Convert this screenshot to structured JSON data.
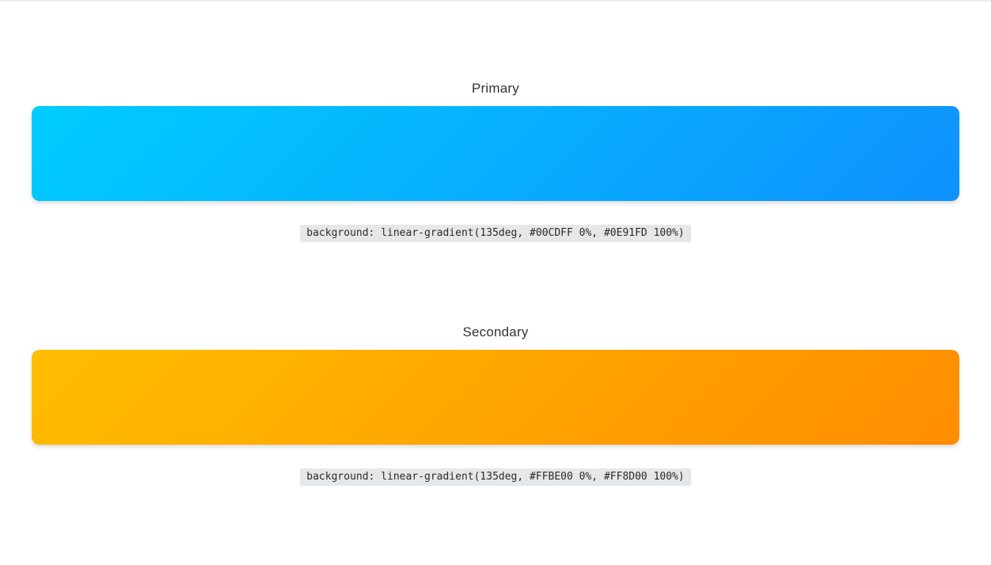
{
  "gradients": [
    {
      "title": "Primary",
      "start_color": "#00CDFF",
      "end_color": "#0E91FD",
      "css": "background: linear-gradient(135deg, #00CDFF 0%, #0E91FD 100%)"
    },
    {
      "title": "Secondary",
      "start_color": "#FFBE00",
      "end_color": "#FF8D00",
      "css": "background: linear-gradient(135deg, #FFBE00 0%, #FF8D00 100%)"
    }
  ]
}
